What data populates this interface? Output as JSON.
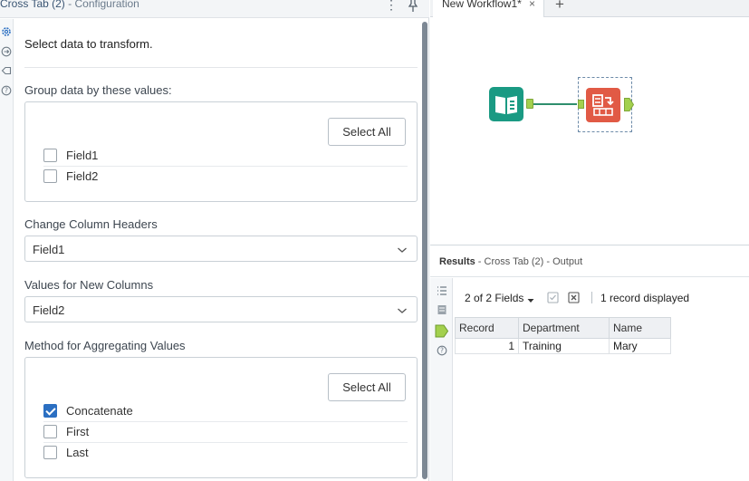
{
  "config": {
    "title": "Cross Tab (2)",
    "subtitle": " - Configuration",
    "intro": "Select data to transform.",
    "group_section": {
      "label": "Group data by these values:",
      "select_all_label": "Select All",
      "fields": [
        {
          "label": "Field1",
          "checked": false
        },
        {
          "label": "Field2",
          "checked": false
        }
      ]
    },
    "headers_section": {
      "label": "Change Column Headers",
      "value": "Field1"
    },
    "values_section": {
      "label": "Values for New Columns",
      "value": "Field2"
    },
    "method_section": {
      "label": "Method for Aggregating Values",
      "select_all_label": "Select All",
      "options": [
        {
          "label": "Concatenate",
          "checked": true
        },
        {
          "label": "First",
          "checked": false
        },
        {
          "label": "Last",
          "checked": false
        }
      ]
    }
  },
  "canvas": {
    "tab_title": "New Workflow1*",
    "tab_close": "×",
    "new_tab": "+"
  },
  "results": {
    "title": "Results",
    "subtitle": " - Cross Tab (2) - Output",
    "fields_label": "2 of 2 Fields",
    "records_label": "1 record displayed",
    "columns": [
      "Record",
      "Department",
      "Name"
    ],
    "rows": [
      [
        "1",
        "Training",
        "Mary"
      ]
    ]
  },
  "colors": {
    "checkbox_checked": "#2b6fc2",
    "input_tool": "#1a9a83",
    "crosstab_tool": "#e15a45",
    "anchor": "#a3d04e"
  }
}
